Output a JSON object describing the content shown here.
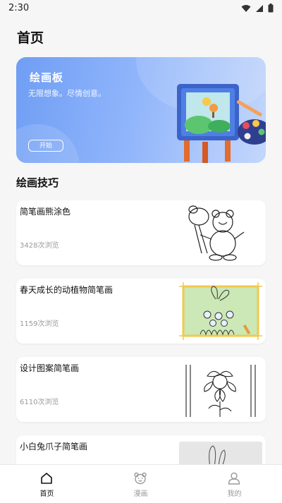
{
  "status": {
    "time": "2:30"
  },
  "page_title": "首页",
  "banner": {
    "title": "绘画板",
    "subtitle": "无限想象。尽情创意。",
    "button_label": "开始"
  },
  "section_title": "绘画技巧",
  "cards": [
    {
      "title": "简笔画熊涂色",
      "views": "3428次浏览",
      "thumb_icon": "bear-drawing-thumbnail"
    },
    {
      "title": "春天成长的动植物简笔画",
      "views": "1159次浏览",
      "thumb_icon": "spring-garden-thumbnail"
    },
    {
      "title": "设计图案简笔画",
      "views": "6110次浏览",
      "thumb_icon": "flower-pattern-thumbnail"
    },
    {
      "title": "小白兔爪子简笔画",
      "views": "",
      "thumb_icon": "rabbit-drawing-thumbnail"
    }
  ],
  "nav": [
    {
      "label": "首页",
      "icon": "home-icon",
      "active": true
    },
    {
      "label": "漫画",
      "icon": "bear-icon",
      "active": false
    },
    {
      "label": "我的",
      "icon": "user-icon",
      "active": false
    }
  ]
}
